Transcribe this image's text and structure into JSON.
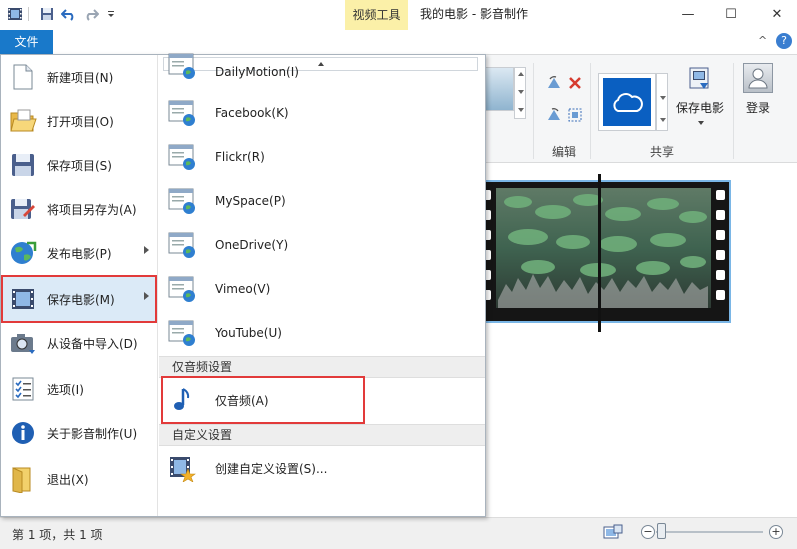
{
  "window": {
    "title": "我的电影 - 影音制作",
    "context_tab": "视频工具",
    "minimize_icon": "—",
    "maximize_icon": "☐",
    "close_icon": "✕"
  },
  "ribbon": {
    "file_tab": "文件",
    "collapse_icon": "^",
    "help_icon": "?",
    "groups": {
      "edit_label": "编辑",
      "share_label": "共享"
    },
    "save_movie_label": "保存电影",
    "signin_label": "登录"
  },
  "file_menu": {
    "items": [
      {
        "label": "新建项目(N)",
        "icon": "new-project-icon"
      },
      {
        "label": "打开项目(O)",
        "icon": "open-folder-icon"
      },
      {
        "label": "保存项目(S)",
        "icon": "save-icon"
      },
      {
        "label": "将项目另存为(A)",
        "icon": "save-as-icon"
      },
      {
        "label": "发布电影(P)",
        "icon": "publish-globe-icon"
      },
      {
        "label": "保存电影(M)",
        "icon": "film-icon"
      },
      {
        "label": "从设备中导入(D)",
        "icon": "camera-import-icon"
      },
      {
        "label": "选项(I)",
        "icon": "options-list-icon"
      },
      {
        "label": "关于影音制作(U)",
        "icon": "info-icon"
      },
      {
        "label": "退出(X)",
        "icon": "exit-icon"
      }
    ],
    "submenu": {
      "scroll_up_icon": "scroll-up-icon",
      "web_items": [
        {
          "label": "DailyMotion(I)"
        },
        {
          "label": "Facebook(K)"
        },
        {
          "label": "Flickr(R)"
        },
        {
          "label": "MySpace(P)"
        },
        {
          "label": "OneDrive(Y)"
        },
        {
          "label": "Vimeo(V)"
        },
        {
          "label": "YouTube(U)"
        }
      ],
      "audio_section_label": "仅音频设置",
      "audio_item_label": "仅音频(A)",
      "custom_section_label": "自定义设置",
      "custom_item_label": "创建自定义设置(S)..."
    }
  },
  "status": {
    "text": "第 1 项，共 1 项",
    "zoom_minus": "−",
    "zoom_plus": "+"
  },
  "colors": {
    "file_tab": "#1979ca",
    "context_tab": "#fbf0a8",
    "highlight_outline": "#e23a3a",
    "selected_bg": "#dbeaf7"
  }
}
